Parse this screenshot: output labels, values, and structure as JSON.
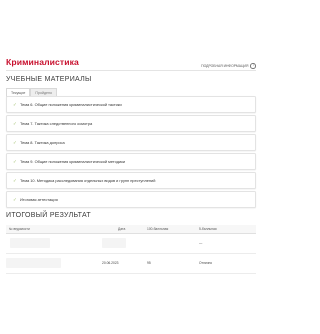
{
  "header": {
    "title": "Криминалистика",
    "info_link": "ПОДРОБНАЯ ИНФОРМАЦИЯ",
    "info_icon": "info-icon"
  },
  "materials": {
    "heading": "УЧЕБНЫЕ МАТЕРИАЛЫ",
    "tabs": [
      {
        "label": "Текущие",
        "active": false
      },
      {
        "label": "Пройдено",
        "active": true
      }
    ],
    "items": [
      "Тема 6. Общие положения криминалистической тактики",
      "Тема 7. Тактика следственного осмотра",
      "Тема 8. Тактика допроса",
      "Тема 9. Общие положения криминалистической методики",
      "Тема 10. Методика расследования отдельных видов и групп преступлений",
      "Итоговая аттестация"
    ],
    "check_icon": "checkmark-icon"
  },
  "results": {
    "heading": "ИТОГОВЫЙ РЕЗУЛЬТАТ",
    "columns": [
      "№ ведомости",
      "Дата",
      "100-балльная",
      "5-балльная"
    ],
    "rows": [
      {
        "number": "",
        "date": "",
        "score100": "",
        "score5": "—"
      },
      {
        "number": "",
        "date": "20.06.2023",
        "score100": "95",
        "score5": "Отлично"
      }
    ]
  }
}
